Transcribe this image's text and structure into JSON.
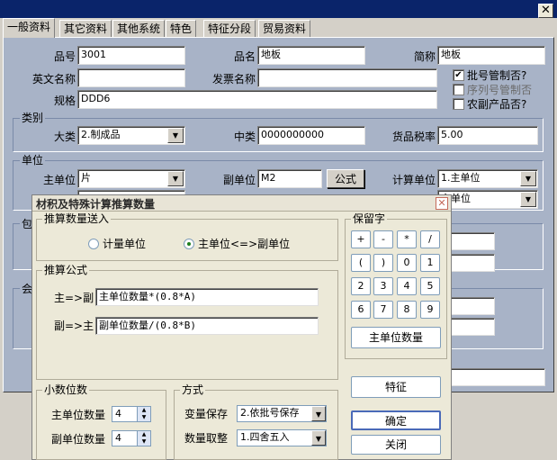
{
  "tabs": [
    "一般资料",
    "其它资料",
    "其他系统",
    "特色",
    "特征分段",
    "贸易资料"
  ],
  "main": {
    "item_no_label": "品号",
    "item_no": "3001",
    "item_name_label": "品名",
    "item_name": "地板",
    "short_name_label": "简称",
    "short_name": "地板",
    "english_name_label": "英文名称",
    "english_name": "",
    "invoice_name_label": "发票名称",
    "invoice_name": "",
    "spec_label": "规格",
    "spec": "DDD6",
    "chk_batch_label": "批号管制否?",
    "chk_serial_label": "序列号管制否",
    "chk_agri_label": "农副产品否?"
  },
  "category": {
    "title": "类别",
    "major_label": "大类",
    "major_value": "2.制成品",
    "middle_label": "中类",
    "middle_value": "0000000000",
    "tax_label": "货品税率",
    "tax_value": "5.00"
  },
  "unit": {
    "title": "单位",
    "main_label": "主单位",
    "main_value": "片",
    "sub_label": "副单位",
    "sub_value": "M2",
    "formula_btn": "公式",
    "calc_label": "计算单位",
    "calc_value": "1.主单位",
    "calc_value2": "主单位"
  },
  "partial_labels": {
    "pack": "包",
    "acct": "会"
  },
  "dialog": {
    "title": "材积及特殊计算推算数量",
    "push_title": "推算数量送入",
    "radio_calc_unit": "计量单位",
    "radio_main_sub": "主单位<=>副单位",
    "formula_title": "推算公式",
    "main_to_sub_label": "主=>副",
    "main_to_sub_value": "主单位数量*(0.8*A)",
    "sub_to_main_label": "副=>主",
    "sub_to_main_value": "副单位数量/(0.8*B)",
    "reserved_title": "保留字",
    "keys": [
      "+",
      "-",
      "*",
      "/",
      "(",
      ")",
      "0",
      "1",
      "2",
      "3",
      "4",
      "5",
      "6",
      "7",
      "8",
      "9"
    ],
    "main_qty_btn": "主单位数量",
    "feature_btn": "特征",
    "decimal_title": "小数位数",
    "main_qty_label": "主单位数量",
    "main_qty_value": "4",
    "sub_qty_label": "副单位数量",
    "sub_qty_value": "4",
    "method_title": "方式",
    "var_save_label": "变量保存",
    "var_save_value": "2.依批号保存",
    "round_label": "数量取整",
    "round_value": "1.四舍五入",
    "ok_btn": "确定",
    "close_btn": "关闭"
  },
  "colors": {
    "title_bar": "#0a246a",
    "panel_bg": "#a8b3c7",
    "dialog_bg": "#ece9d8"
  }
}
